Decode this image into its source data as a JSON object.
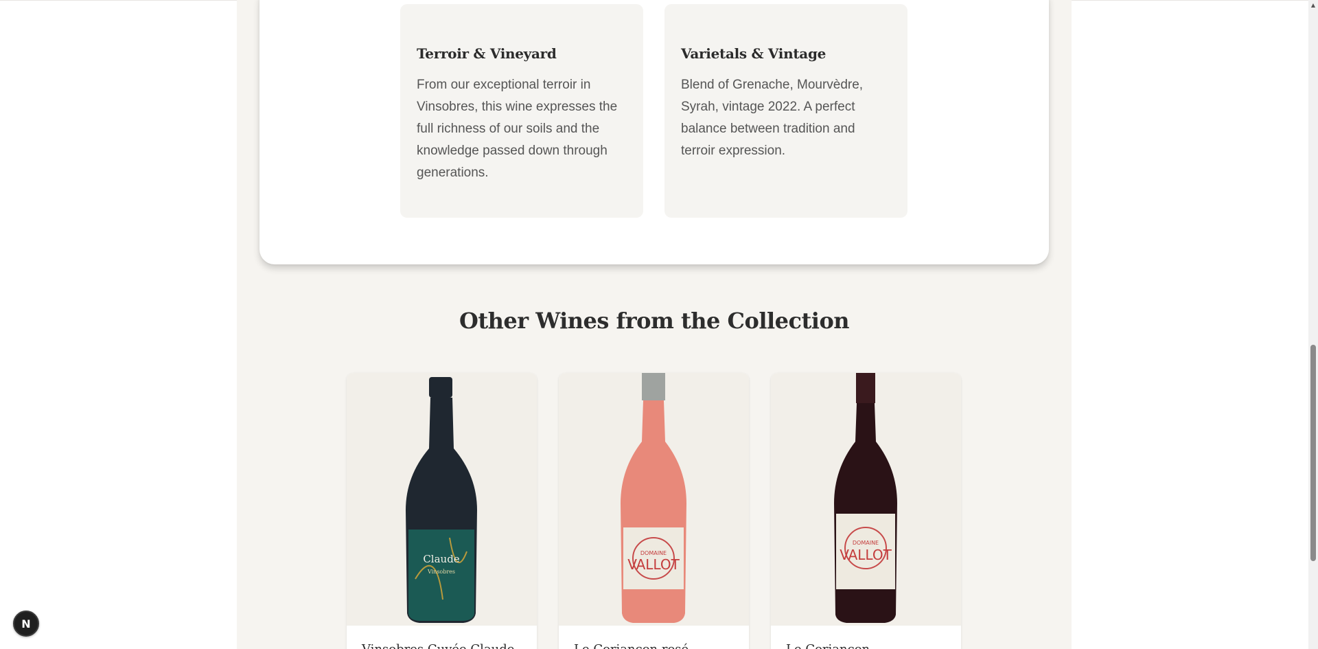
{
  "info_cards": [
    {
      "title": "Terroir & Vineyard",
      "text": "From our exceptional terroir in Vinsobres, this wine expresses the full richness of our soils and the knowledge passed down through generations."
    },
    {
      "title": "Varietals & Vintage",
      "text": "Blend of Grenache, Mourvèdre, Syrah, vintage 2022. A perfect balance between tradition and terroir expression."
    }
  ],
  "collection": {
    "title": "Other Wines from the Collection",
    "wines": [
      {
        "name": "Vinsobres Cuvée Claude",
        "bottle_color": "#1f2730",
        "label_color": "#1b5a54",
        "label_text": "Claude",
        "label_subtext": "Vinsobres"
      },
      {
        "name": "Le Coriançon rosé",
        "bottle_color": "#e8897a",
        "label_color": "#eeeae0",
        "label_text": "VALLOT",
        "label_subtext": "DOMAINE"
      },
      {
        "name": "Le Coriançon",
        "bottle_color": "#2a1216",
        "label_color": "#eeeae0",
        "label_text": "VALLOT",
        "label_subtext": "DOMAINE"
      }
    ]
  },
  "dev_badge": {
    "letter": "N"
  },
  "scrollbar": {
    "up_arrow": "▲"
  }
}
